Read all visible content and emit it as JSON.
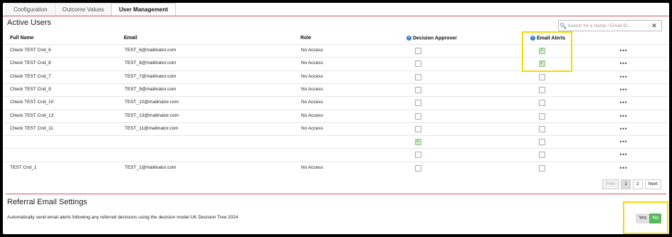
{
  "tabs": [
    "Configuration",
    "Outcome Values",
    "User Management"
  ],
  "active_users": {
    "title": "Active Users",
    "search_placeholder": "Search for a Name / Email ID...",
    "columns": {
      "full_name": "Full Name",
      "email": "Email",
      "role": "Role",
      "decision_approver": "Decision Approver",
      "email_alerts": "Email Alerts"
    },
    "rows": [
      {
        "name": "Check TEST Cnd_6",
        "email": "TEST_6@mailinator.com",
        "role": "No Access",
        "approver": false,
        "alerts": true
      },
      {
        "name": "Check TEST Cnd_8",
        "email": "TEST_8@mailinator.com",
        "role": "No Access",
        "approver": false,
        "alerts": true
      },
      {
        "name": "Check TEST Cnd_7",
        "email": "TEST_7@mailinator.com",
        "role": "No Access",
        "approver": false,
        "alerts": false
      },
      {
        "name": "Check TEST Cnd_9",
        "email": "TEST_9@mailinator.com",
        "role": "No Access",
        "approver": false,
        "alerts": false
      },
      {
        "name": "Check TEST Cnd_10",
        "email": "TEST_10@mailinator.com",
        "role": "No Access",
        "approver": false,
        "alerts": false
      },
      {
        "name": "Check TEST Cnd_13",
        "email": "TEST_13@mailinator.com",
        "role": "No Access",
        "approver": false,
        "alerts": false
      },
      {
        "name": "Check TEST Cnd_11",
        "email": "TEST_11@mailinator.com",
        "role": "No Access",
        "approver": false,
        "alerts": false
      },
      {
        "name": "",
        "email": "",
        "role": "",
        "approver": true,
        "alerts": false
      },
      {
        "name": "",
        "email": "",
        "role": "",
        "approver": false,
        "alerts": false
      },
      {
        "name": "TEST Cnd_1",
        "email": "TEST_1@mailinator.com",
        "role": "No Access",
        "approver": false,
        "alerts": false
      }
    ],
    "more_icon": "⋯"
  },
  "pagination": {
    "prev": "Prev",
    "pages": [
      "1",
      "2"
    ],
    "next": "Next"
  },
  "referral": {
    "title": "Referral Email Settings",
    "description": "Automatically send email alerts following any referred decisions using the decision model UK Decision Tree 2024",
    "yes": "Yes",
    "no": "No",
    "selected": "No"
  },
  "colors": {
    "accent_rule": "#d05a5a",
    "highlight": "#f5d90a",
    "no_button": "#5cb85c",
    "info_icon": "#3a7bd5"
  }
}
